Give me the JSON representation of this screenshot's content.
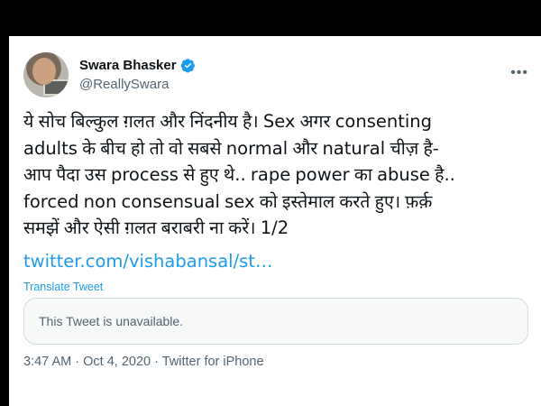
{
  "tweet": {
    "author": {
      "display_name": "Swara Bhasker",
      "handle": "@ReallySwara",
      "verified": true,
      "verified_color": "#1d9bf0"
    },
    "text_lines": [
      "ये सोच बिल्कुल ग़लत और निंदनीय है। Sex अगर consenting",
      "adults के बीच हो तो वो सबसे normal और natural चीज़ है-",
      "आप पैदा उस process से हुए थे.. rape power का abuse है..",
      "forced non consensual sex को इस्तेमाल करते हुए। फ़र्क़",
      "समझें और ऐसी ग़लत बराबरी ना करें। 1/2"
    ],
    "link_text": "twitter.com/vishabansal/st…",
    "translate_label": "Translate Tweet",
    "quoted_unavailable": "This Tweet is unavailable.",
    "time": "3:47 AM",
    "date": "Oct 4, 2020",
    "source": "Twitter for iPhone",
    "separator": "·",
    "more_icon": "more-horizontal-icon"
  }
}
